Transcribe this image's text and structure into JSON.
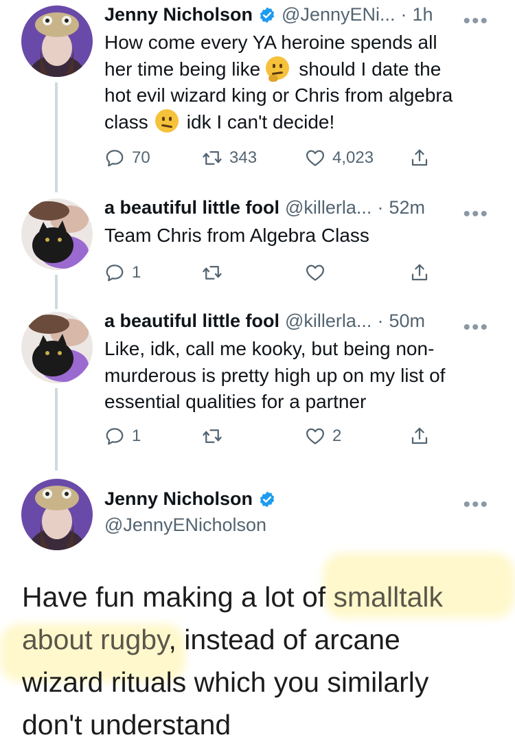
{
  "tweets": [
    {
      "name": "Jenny Nicholson",
      "handle": "@JennyENi...",
      "time": "1h",
      "text_lines": [
        "How come every YA heroine spends all",
        "her time being like",
        "should I date the",
        "hot evil wizard king or Chris from algebra",
        "class",
        "idk I can't decide!"
      ],
      "replies": "70",
      "retweets": "343",
      "likes": "4,023"
    },
    {
      "name": "a beautiful little fool",
      "handle": "@killerla...",
      "time": "52m",
      "text": "Team Chris from Algebra Class",
      "replies": "1",
      "retweets": "",
      "likes": ""
    },
    {
      "name": "a beautiful little fool",
      "handle": "@killerla...",
      "time": "50m",
      "text_lines": [
        "Like, idk, call me kooky, but being non-",
        "murderous is pretty high up on my list of",
        "essential qualities for a partner"
      ],
      "replies": "1",
      "retweets": "",
      "likes": "2"
    }
  ],
  "main_tweet": {
    "name": "Jenny Nicholson",
    "handle": "@JennyENicholson",
    "text_lines": [
      [
        "Have fun making a lot of ",
        "smalltalk"
      ],
      [
        "about rugby",
        ", instead of arcane"
      ],
      [
        "wizard rituals which you similarly"
      ],
      [
        "don't understand"
      ]
    ]
  },
  "header_separator": "·",
  "more_label": "•••",
  "colors": {
    "verified": "#1d9bf0",
    "highlight": "#fff8cc",
    "thread_line": "#cfd9de",
    "secondary_text": "#536471"
  },
  "icons": [
    "reply-icon",
    "retweet-icon",
    "like-icon",
    "share-icon",
    "verified-badge-icon",
    "thinking-face-emoji",
    "confused-face-emoji",
    "more-options-icon"
  ]
}
